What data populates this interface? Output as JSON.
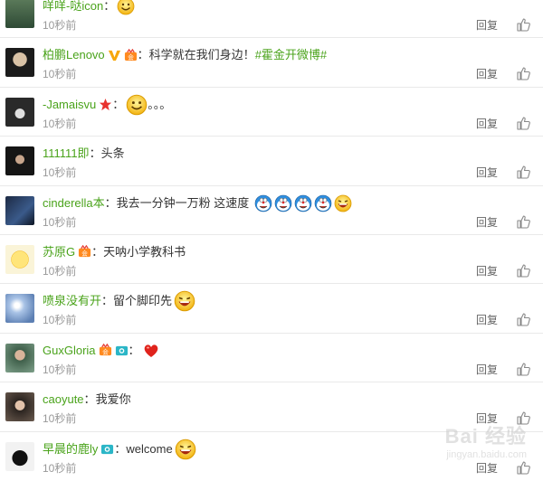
{
  "reply_label": "回复",
  "comments": [
    {
      "user": "咩咩-哒icon",
      "sep": "：",
      "text": "",
      "time": "10秒前"
    },
    {
      "user": "柏鹏Lenovo",
      "sep": "：",
      "text": "科学就在我们身边！",
      "hashtag": "#霍金开微博#",
      "time": "10秒前"
    },
    {
      "user": "-Jamaisvu",
      "sep": "：",
      "text": "。。。",
      "time": "10秒前"
    },
    {
      "user": "111111即",
      "sep": "：",
      "text": "头条",
      "time": "10秒前"
    },
    {
      "user": "cinderella本",
      "sep": "：",
      "text": "我去一分钟一万粉 这速度",
      "time": "10秒前"
    },
    {
      "user": "苏原G",
      "sep": "：",
      "text": "天呐小学教科书",
      "time": "10秒前"
    },
    {
      "user": "喷泉没有开",
      "sep": "：",
      "text": "留个脚印先",
      "time": "10秒前"
    },
    {
      "user": "GuxGloria",
      "sep": "：",
      "text": "",
      "time": "10秒前"
    },
    {
      "user": "caoyute",
      "sep": "：",
      "text": "我爱你",
      "time": "10秒前"
    },
    {
      "user": "早晨的鹿ly",
      "sep": "：",
      "text": "welcome",
      "time": "10秒前"
    }
  ],
  "watermark": "Bai 经验",
  "watermark_sub": "jingyan.baidu.com",
  "colors": {
    "username": "#4aa31b",
    "time": "#999999",
    "divider": "#e9e9e9"
  }
}
